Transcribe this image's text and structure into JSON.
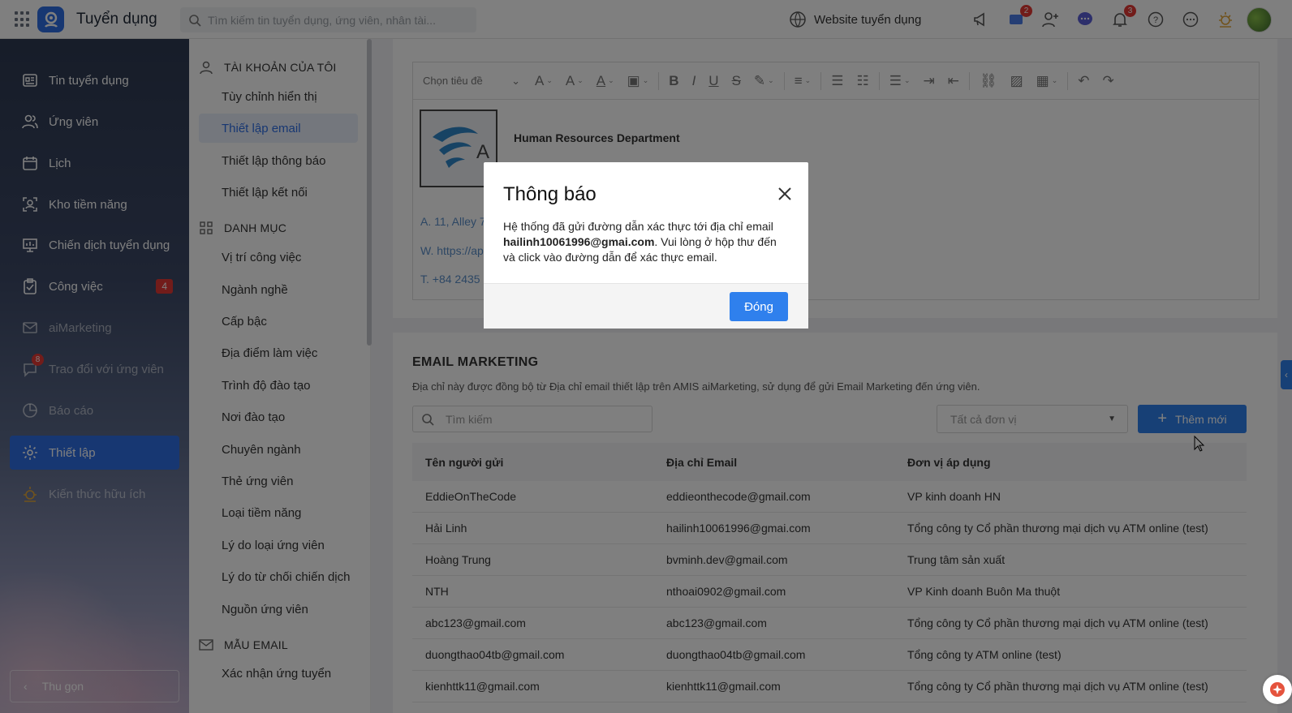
{
  "app": {
    "title": "Tuyển dụng"
  },
  "topbar": {
    "search_placeholder": "Tìm kiếm tin tuyển dụng, ứng viên, nhân tài...",
    "website_label": "Website tuyển dụng",
    "cart_badge": "2",
    "notify_badge": "3"
  },
  "sidebar": {
    "items": [
      {
        "label": "Tin tuyển dụng",
        "icon": "newspaper-icon"
      },
      {
        "label": "Ứng viên",
        "icon": "users-icon"
      },
      {
        "label": "Lịch",
        "icon": "calendar-icon"
      },
      {
        "label": "Kho tiềm năng",
        "icon": "talent-pool-icon"
      },
      {
        "label": "Chiến dịch tuyển dụng",
        "icon": "presentation-icon"
      },
      {
        "label": "Công việc",
        "icon": "clipboard-check-icon",
        "badge": "4"
      },
      {
        "label": "aiMarketing",
        "icon": "mail-icon"
      },
      {
        "label": "Trao đổi với ứng viên",
        "icon": "chat-icon",
        "badge": "8"
      },
      {
        "label": "Báo cáo",
        "icon": "pie-chart-icon"
      },
      {
        "label": "Thiết lập",
        "icon": "gear-icon"
      },
      {
        "label": "Kiến thức hữu ích",
        "icon": "lightbulb-icon"
      }
    ],
    "collapse_label": "Thu gọn"
  },
  "submenu": {
    "account_header": "TÀI KHOẢN CỦA TÔI",
    "account_items": [
      "Tùy chỉnh hiển thị",
      "Thiết lập email",
      "Thiết lập thông báo",
      "Thiết lập kết nối"
    ],
    "category_header": "DANH MỤC",
    "category_items": [
      "Vị trí công việc",
      "Ngành nghề",
      "Cấp bậc",
      "Địa điểm làm việc",
      "Trình độ đào tạo",
      "Nơi đào tạo",
      "Chuyên ngành",
      "Thẻ ứng viên",
      "Loại tiềm năng",
      "Lý do loại ứng viên",
      "Lý do từ chối chiến dịch",
      "Nguồn ứng viên"
    ],
    "email_header": "MẪU EMAIL",
    "email_items": [
      "Xác nhận ứng tuyển"
    ]
  },
  "editor": {
    "heading_select": "Chọn tiêu đề",
    "signature_name": "Human Resources Department",
    "addr_line": "A. 11, Alley 7",
    "web_line": "W. https://ap",
    "phone_line": "T. +84 2435"
  },
  "email_marketing": {
    "title": "EMAIL MARKETING",
    "description": "Địa chỉ này được đồng bộ từ Địa chỉ email thiết lập trên AMIS aiMarketing, sử dụng để gửi Email Marketing đến ứng viên.",
    "search_placeholder": "Tìm kiếm",
    "unit_select": "Tất cả đơn vị",
    "add_label": "Thêm mới",
    "columns": [
      "Tên người gửi",
      "Địa chỉ Email",
      "Đơn vị áp dụng"
    ],
    "rows": [
      [
        "EddieOnTheCode",
        "eddieonthecode@gmail.com",
        "VP kinh doanh HN"
      ],
      [
        "Hải Linh",
        "hailinh10061996@gmai.com",
        "Tổng công ty Cổ phần thương mại dịch vụ ATM online (test)"
      ],
      [
        "Hoàng Trung",
        "bvminh.dev@gmail.com",
        "Trung tâm sản xuất"
      ],
      [
        "NTH",
        "nthoai0902@gmail.com",
        "VP Kinh doanh Buôn Ma thuột"
      ],
      [
        "abc123@gmail.com",
        "abc123@gmail.com",
        "Tổng công ty Cổ phần thương mại dịch vụ ATM online (test)"
      ],
      [
        "duongthao04tb@gmail.com",
        "duongthao04tb@gmail.com",
        "Tổng công ty ATM online (test)"
      ],
      [
        "kienhttk11@gmail.com",
        "kienhttk11@gmail.com",
        "Tổng công ty Cổ phần thương mại dịch vụ ATM online (test)"
      ]
    ]
  },
  "modal": {
    "title": "Thông báo",
    "text_before": "Hệ thống đã gửi đường dẫn xác thực tới địa chỉ email ",
    "email": "hailinh10061996@gmai.com",
    "text_after": ". Vui lòng ở hộp thư đến và click vào đường dẫn để xác thực email.",
    "close_label": "Đóng"
  },
  "colors": {
    "primary": "#2f80ed",
    "badge": "#e53935"
  }
}
